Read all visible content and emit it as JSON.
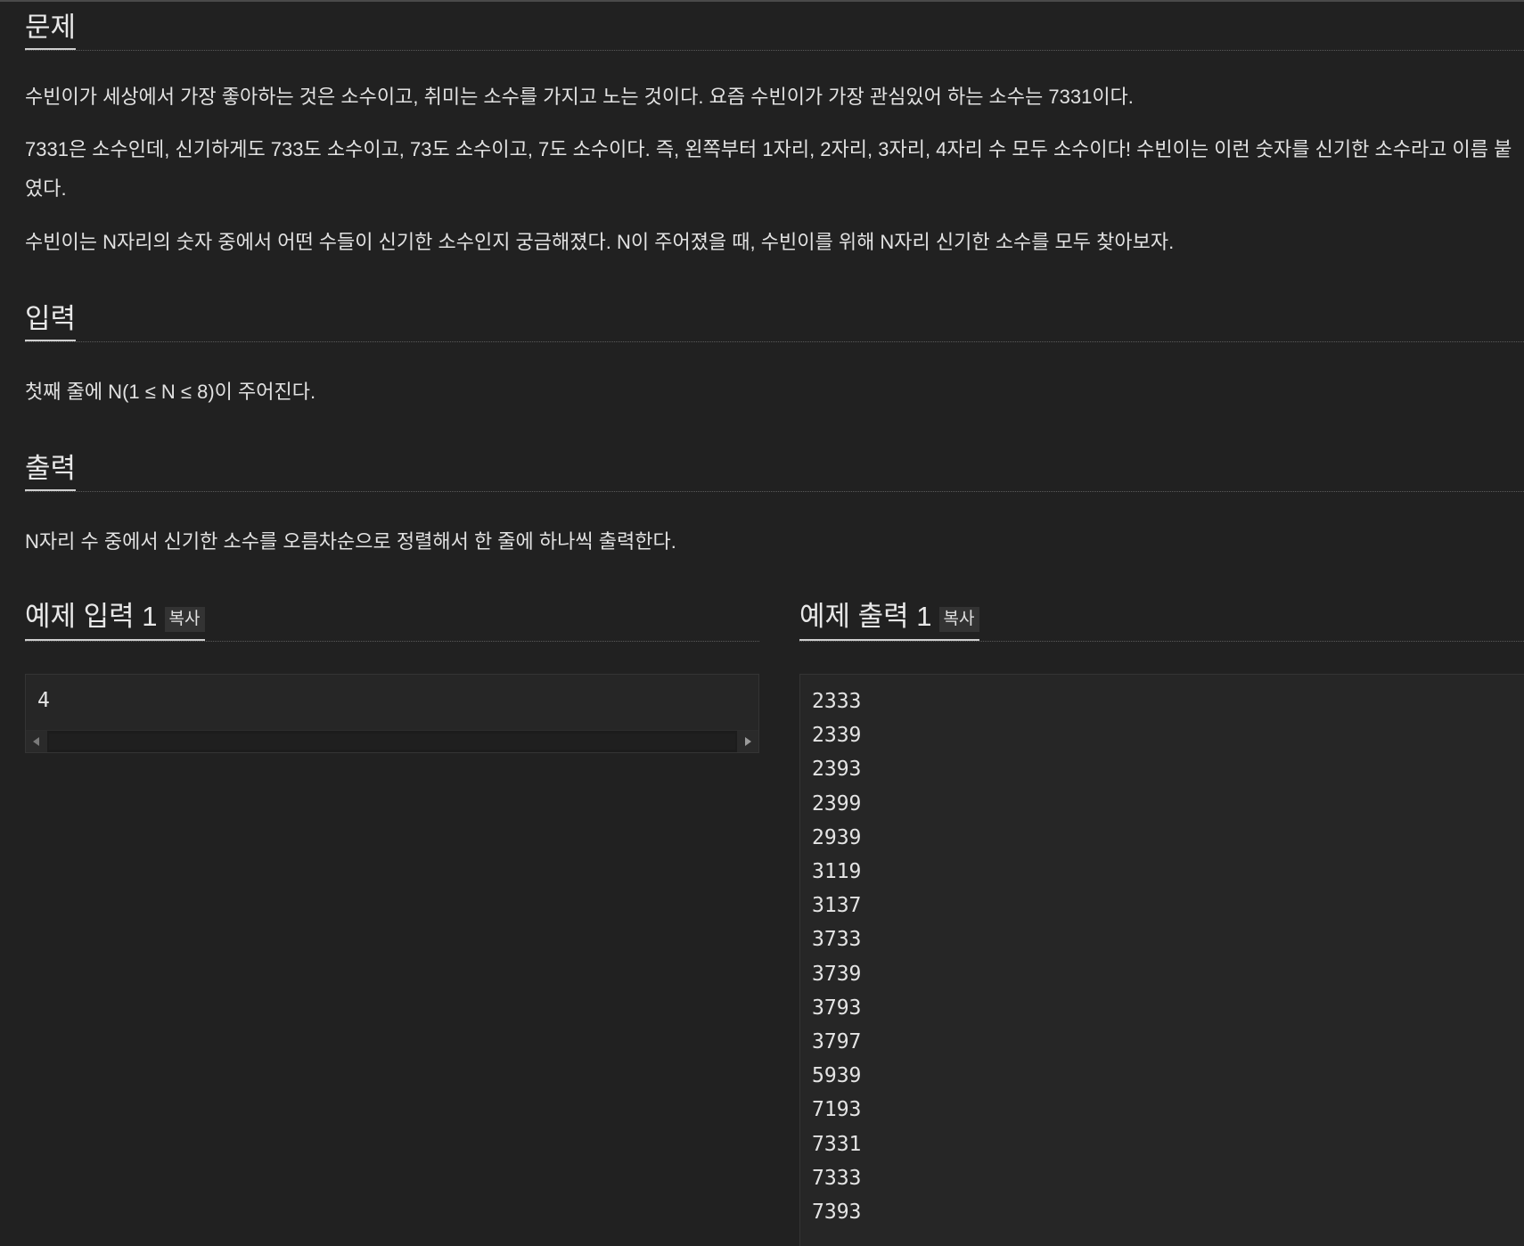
{
  "sections": {
    "problem": {
      "title": "문제",
      "paragraphs": [
        "수빈이가 세상에서 가장 좋아하는 것은 소수이고, 취미는 소수를 가지고 노는 것이다. 요즘 수빈이가 가장 관심있어 하는 소수는 7331이다.",
        "7331은 소수인데, 신기하게도 733도 소수이고, 73도 소수이고, 7도 소수이다. 즉, 왼쪽부터 1자리, 2자리, 3자리, 4자리 수 모두 소수이다! 수빈이는 이런 숫자를 신기한 소수라고 이름 붙였다.",
        "수빈이는 N자리의 숫자 중에서 어떤 수들이 신기한 소수인지 궁금해졌다. N이 주어졌을 때, 수빈이를 위해 N자리 신기한 소수를 모두 찾아보자."
      ]
    },
    "input": {
      "title": "입력",
      "text": "첫째 줄에 N(1 ≤ N ≤ 8)이 주어진다."
    },
    "output": {
      "title": "출력",
      "text": "N자리 수 중에서 신기한 소수를 오름차순으로 정렬해서 한 줄에 하나씩 출력한다."
    },
    "sample_input": {
      "title": "예제 입력 1",
      "copy_label": "복사",
      "content": "4"
    },
    "sample_output": {
      "title": "예제 출력 1",
      "copy_label": "복사",
      "content": "2333\n2339\n2393\n2399\n2939\n3119\n3137\n3733\n3739\n3793\n3797\n5939\n7193\n7331\n7333\n7393"
    }
  },
  "icons": {
    "scroll_left": "triangle-left-icon",
    "scroll_right": "triangle-right-icon"
  },
  "colors": {
    "background": "#212121",
    "text": "#e2e2e2",
    "box_background": "#262626"
  }
}
